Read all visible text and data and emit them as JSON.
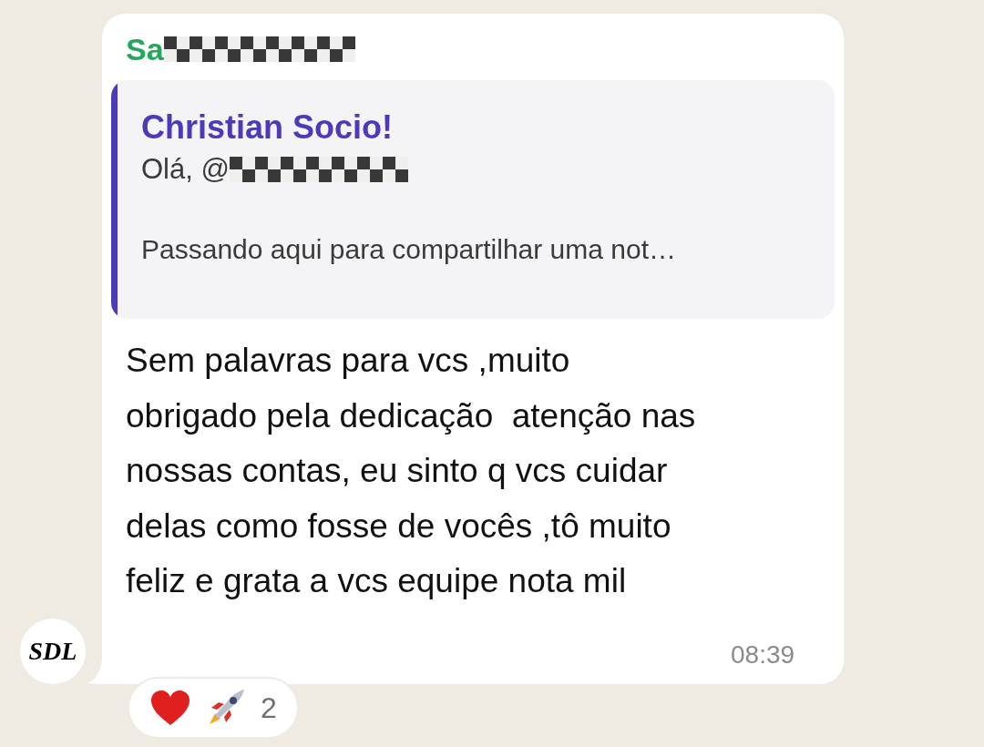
{
  "message": {
    "sender": "Sa",
    "quote": {
      "author": "Christian Socio!",
      "greeting": "Olá, @",
      "preview": "Passando aqui para compartilhar uma not…"
    },
    "text": "Sem palavras para vcs ,muito obrigado pela dedicação  atenção nas nossas contas, eu sinto q vcs cuidar delas como fosse de vocês ,tô muito feliz e grata a vcs equipe nota mil",
    "time": "08:39",
    "avatar": {
      "text": "SDL"
    },
    "reactions": {
      "count": "2"
    }
  }
}
